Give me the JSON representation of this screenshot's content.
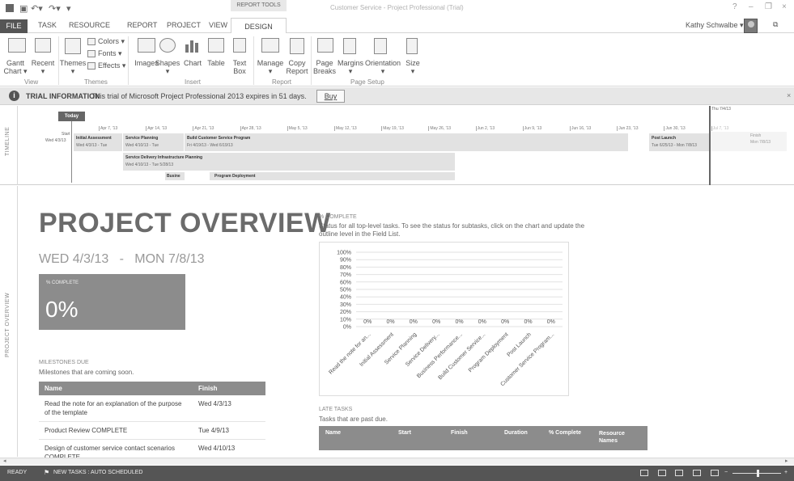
{
  "title_bar": {
    "window_title": "Customer Service - Project Professional (Trial)",
    "quick_access": [
      "save-icon",
      "undo-icon",
      "redo-icon"
    ],
    "window_buttons": [
      "?",
      "–",
      "❐",
      "×"
    ]
  },
  "ribbon_tabs": {
    "file": "FILE",
    "task": "TASK",
    "resource": "RESOURCE",
    "report": "REPORT",
    "project": "PROJECT",
    "view": "VIEW",
    "tools_label": "REPORT TOOLS",
    "design": "DESIGN"
  },
  "user": {
    "name": "Kathy Schwalbe ▾"
  },
  "ribbon": {
    "view": {
      "label": "View",
      "gantt": "Gantt\nChart ▾",
      "recent": "Recent\n▾"
    },
    "themes": {
      "label": "Themes",
      "themes": "Themes\n▾",
      "colors": "Colors ▾",
      "fonts": "Fonts ▾",
      "effects": "Effects ▾"
    },
    "insert": {
      "label": "Insert",
      "images": "Images",
      "shapes": "Shapes\n▾",
      "chart": "Chart",
      "table": "Table",
      "textbox": "Text\nBox"
    },
    "report": {
      "label": "Report",
      "manage": "Manage\n▾",
      "copy": "Copy\nReport"
    },
    "page_setup": {
      "label": "Page Setup",
      "breaks": "Page\nBreaks",
      "margins": "Margins\n▾",
      "orientation": "Orientation\n▾",
      "size": "Size\n▾"
    }
  },
  "info_bar": {
    "title": "TRIAL INFORMATION",
    "text": "This trial of Microsoft Project Professional 2013 expires in 51 days.",
    "buy": "Buy"
  },
  "timeline": {
    "side_label": "TIMELINE",
    "today": "Today",
    "start_label": "Start",
    "start_date": "Wed 4/3/13",
    "finish_label": "Finish",
    "finish_date": "Mon 7/8/13",
    "current_date": "Thu 7/4/13",
    "ticks": [
      "Apr 7, '13",
      "Apr 14, '13",
      "Apr 21, '13",
      "Apr 28, '13",
      "May 5, '13",
      "May 12, '13",
      "May 19, '13",
      "May 26, '13",
      "Jun 2, '13",
      "Jun 9, '13",
      "Jun 16, '13",
      "Jun 23, '13",
      "Jun 30, '13",
      "Jul 7, '13"
    ],
    "tasks": [
      {
        "name": "Initial Assessment",
        "dates": "Wed 4/3/13 - Tue"
      },
      {
        "name": "Service Planning",
        "dates": "Wed 4/10/13 - Tue"
      },
      {
        "name": "Build Customer Service Program",
        "dates": "Fri 4/19/13 - Wed 6/19/13"
      },
      {
        "name": "Post Launch",
        "dates": "Tue 6/25/13 - Mon 7/8/13"
      },
      {
        "name": "Service Delivery Infrastructure Planning",
        "dates": "Wed 4/10/13 - Tue 5/28/13"
      },
      {
        "name": "Busine",
        "dates": ""
      },
      {
        "name": "Program Deployment",
        "dates": ""
      }
    ]
  },
  "report": {
    "side_label": "PROJECT OVERVIEW",
    "title": "PROJECT OVERVIEW",
    "start": "WED 4/3/13",
    "separator": "-",
    "finish": "MON 7/8/13",
    "pct_label": "% COMPLETE",
    "pct_value": "0%",
    "milestones": {
      "heading": "MILESTONES DUE",
      "desc": "Milestones that are coming soon.",
      "columns": [
        "Name",
        "Finish"
      ],
      "rows": [
        [
          "Read the note for an explanation of the purpose of the template",
          "Wed 4/3/13"
        ],
        [
          "Product Review COMPLETE",
          "Tue 4/9/13"
        ],
        [
          "Design of customer service contact scenarios COMPLETE",
          "Wed 4/10/13"
        ]
      ]
    },
    "chart_section": {
      "heading": "% COMPLETE",
      "desc": "Status for all top-level tasks. To see the status for subtasks, click on the chart and update the outline level in the Field List."
    },
    "late": {
      "heading": "LATE TASKS",
      "desc": "Tasks that are past due.",
      "columns": [
        "Name",
        "Start",
        "Finish",
        "Duration",
        "% Complete",
        "Resource\nNames"
      ]
    }
  },
  "chart_data": {
    "type": "bar",
    "categories": [
      "Read the note for an...",
      "Initial Assessment",
      "Service Planning",
      "Service Delivery...",
      "Business Performance...",
      "Build Customer Service...",
      "Program Deployment",
      "Post Launch",
      "Customer Service Program..."
    ],
    "values": [
      0,
      0,
      0,
      0,
      0,
      0,
      0,
      0,
      0
    ],
    "data_labels": [
      "0%",
      "0%",
      "0%",
      "0%",
      "0%",
      "0%",
      "0%",
      "0%",
      "0%"
    ],
    "yticks": [
      "100%",
      "90%",
      "80%",
      "70%",
      "60%",
      "50%",
      "40%",
      "30%",
      "20%",
      "10%",
      "0%"
    ],
    "ylim": [
      0,
      100
    ],
    "grid": true,
    "title": "",
    "xlabel": "",
    "ylabel": ""
  },
  "status_bar": {
    "ready": "READY",
    "new_tasks": "NEW TASKS : AUTO SCHEDULED"
  }
}
